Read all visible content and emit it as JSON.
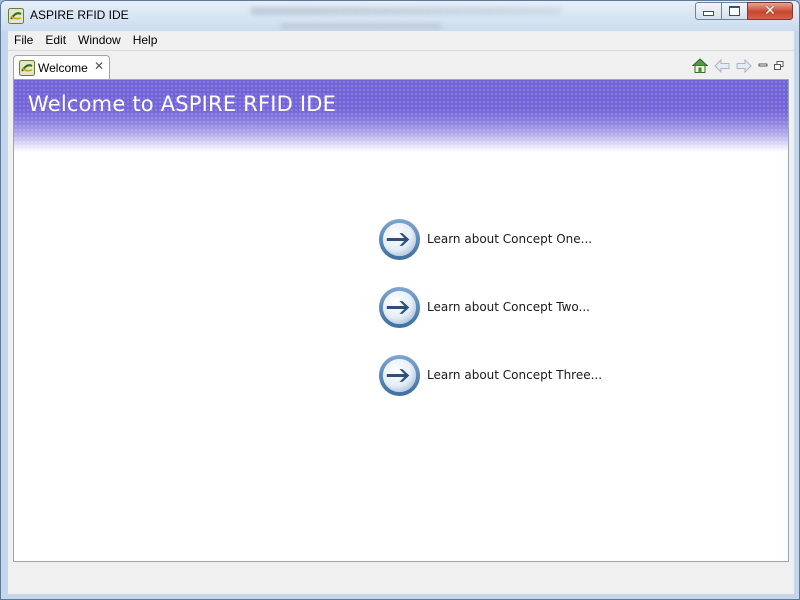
{
  "window": {
    "title": "ASPIRE RFID IDE",
    "close_symbol": "✕"
  },
  "menubar": {
    "items": [
      {
        "label": "File"
      },
      {
        "label": "Edit"
      },
      {
        "label": "Window"
      },
      {
        "label": "Help"
      }
    ]
  },
  "tabs": [
    {
      "label": "Welcome",
      "close_symbol": "✕",
      "icon": "aspire-app-icon"
    }
  ],
  "toolbar": {
    "icons": [
      "home-icon",
      "back-arrow-icon",
      "forward-arrow-icon",
      "minimize-view-icon",
      "maximize-view-icon"
    ]
  },
  "welcome": {
    "banner_title": "Welcome to ASPIRE RFID IDE",
    "links": [
      {
        "label": "Learn about Concept One...",
        "icon": "arrow-circle-icon"
      },
      {
        "label": "Learn about Concept Two...",
        "icon": "arrow-circle-icon"
      },
      {
        "label": "Learn about Concept Three...",
        "icon": "arrow-circle-icon"
      }
    ]
  },
  "colors": {
    "banner": "#7466d9",
    "link_icon_ring": "#5a86b5",
    "link_icon_arrow": "#2e4f7a"
  }
}
